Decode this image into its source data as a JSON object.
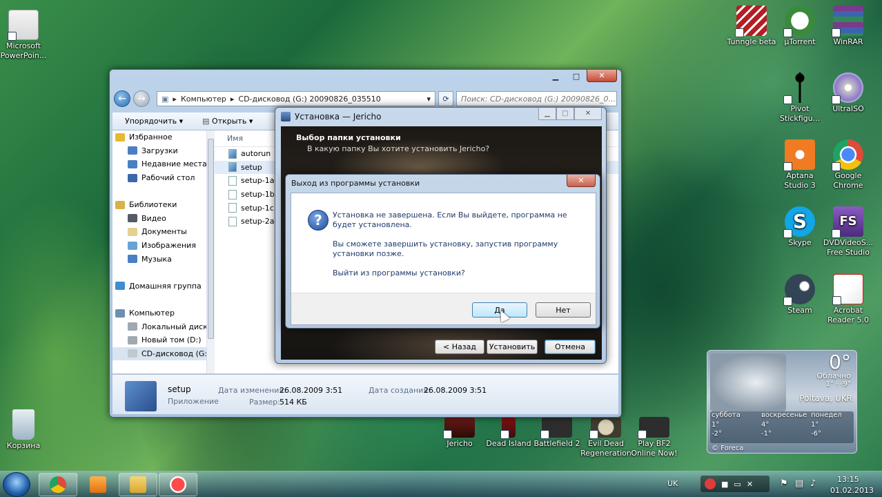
{
  "desktop": {
    "icons_left": [
      {
        "label1": "Microsoft",
        "label2": "PowerPoin...",
        "color": "#d14424"
      },
      {
        "label1": "Корзина",
        "label2": "",
        "color": "#9fb5c8"
      }
    ],
    "icons_right": [
      {
        "label1": "Tunngle beta",
        "label2": "",
        "color": "#b21f24"
      },
      {
        "label1": "µTorrent",
        "label2": "",
        "color": "#3a8a3c"
      },
      {
        "label1": "WinRAR",
        "label2": "",
        "color": "#7b3a8a"
      },
      {
        "label1": "Pivot",
        "label2": "Stickfigu...",
        "color": "#ffffff"
      },
      {
        "label1": "UltraISO",
        "label2": "",
        "color": "#c7c7c7"
      },
      {
        "label1": "Aptana",
        "label2": "Studio 3",
        "color": "#f07b22"
      },
      {
        "label1": "Google",
        "label2": "Chrome",
        "color": "#dd4b39"
      },
      {
        "label1": "Skype",
        "label2": "",
        "color": "#12a5e8"
      },
      {
        "label1": "DVDVideoS...",
        "label2": "Free Studio",
        "color": "#6b3fa0"
      },
      {
        "label1": "Steam",
        "label2": "",
        "color": "#334455"
      },
      {
        "label1": "Acrobat",
        "label2": "Reader 5.0",
        "color": "#c4261d"
      }
    ],
    "icons_bottom": [
      {
        "label1": "Jericho",
        "label2": "",
        "color": "#6e1b16"
      },
      {
        "label1": "Dead Island",
        "label2": "",
        "color": "#3b0f0f"
      },
      {
        "label1": "Battlefield 2",
        "label2": "",
        "color": "#2d2d2d"
      },
      {
        "label1": "Evil Dead",
        "label2": "Regeneration",
        "color": "#3f3b2f"
      },
      {
        "label1": "Play BF2",
        "label2": "Online Now!",
        "color": "#2d2d2d"
      }
    ]
  },
  "explorer": {
    "window_buttons": {
      "minimize": "▁",
      "maximize": "□",
      "close": "✕"
    },
    "address_root": "Компьютер",
    "address_current": "CD-дисковод (G:) 20090826_035510",
    "search_placeholder": "Поиск: CD-дисковод (G:) 20090826_0...",
    "toolbar": {
      "organize": "Упорядочить",
      "open": "Открыть"
    },
    "sidebar": [
      {
        "label": "Избранное",
        "group": true,
        "color": "#e8b830"
      },
      {
        "label": "Загрузки",
        "group": false,
        "color": "#4a7fc4"
      },
      {
        "label": "Недавние места",
        "group": false,
        "color": "#4a7fc4"
      },
      {
        "label": "Рабочий стол",
        "group": false,
        "color": "#3a68a8"
      },
      {
        "label": "",
        "group": false,
        "color": "transparent"
      },
      {
        "label": "Библиотеки",
        "group": true,
        "color": "#d8b14a"
      },
      {
        "label": "Видео",
        "group": false,
        "color": "#555a66"
      },
      {
        "label": "Документы",
        "group": false,
        "color": "#e4d18f"
      },
      {
        "label": "Изображения",
        "group": false,
        "color": "#6aa2d8"
      },
      {
        "label": "Музыка",
        "group": false,
        "color": "#4a7fc4"
      },
      {
        "label": "",
        "group": false,
        "color": "transparent"
      },
      {
        "label": "Домашняя группа",
        "group": true,
        "color": "#3f8fd0"
      },
      {
        "label": "",
        "group": false,
        "color": "transparent"
      },
      {
        "label": "Компьютер",
        "group": true,
        "color": "#6f8fb0"
      },
      {
        "label": "Локальный диск",
        "group": false,
        "color": "#a0a8b0"
      },
      {
        "label": "Новый том (D:)",
        "group": false,
        "color": "#a0a8b0"
      },
      {
        "label": "CD-дисковод (G:",
        "group": false,
        "color": "#c0c8d0"
      }
    ],
    "column_header": "Имя",
    "files": [
      "autorun",
      "setup",
      "setup-1a.bin",
      "setup-1b.bin",
      "setup-1c.bin",
      "setup-2a.bin"
    ],
    "files_visible": [
      "autorun",
      "setup",
      "setup-1a.l",
      "setup-1b.l",
      "setup-1c.l",
      "setup-2a.l"
    ],
    "details": {
      "name": "setup",
      "type": "Приложение",
      "modified_label": "Дата изменения:",
      "modified_value": "26.08.2009 3:51",
      "created_label": "Дата создания:",
      "created_value": "26.08.2009 3:51",
      "size_label": "Размер:",
      "size_value": "514 КБ"
    }
  },
  "installer": {
    "title": "Установка — Jericho",
    "heading": "Выбор папки установки",
    "subheading": "В какую папку Вы хотите установить Jericho?",
    "back": "< Назад",
    "install": "Установить",
    "cancel": "Отмена"
  },
  "exit_dialog": {
    "title": "Выход из программы установки",
    "line1": "Установка не завершена. Если Вы выйдете, программа не будет установлена.",
    "line2": "Вы сможете завершить установку, запустив программу установки позже.",
    "line3": "Выйти из программы установки?",
    "yes": "Да",
    "no": "Нет"
  },
  "weather": {
    "temperature": "0°",
    "condition": "Облачно",
    "range": "1° - -9°",
    "location": "Poltava, UKR",
    "forecast": [
      {
        "day": "суббота",
        "hi": "1°",
        "lo": "-2°"
      },
      {
        "day": "воскресенье",
        "hi": "4°",
        "lo": "-1°"
      },
      {
        "day": "понедел",
        "hi": "1°",
        "lo": "-6°"
      }
    ],
    "source": "© Foreca"
  },
  "taskbar": {
    "language": "UK",
    "time": "13:15",
    "date": "01.02.2013"
  }
}
